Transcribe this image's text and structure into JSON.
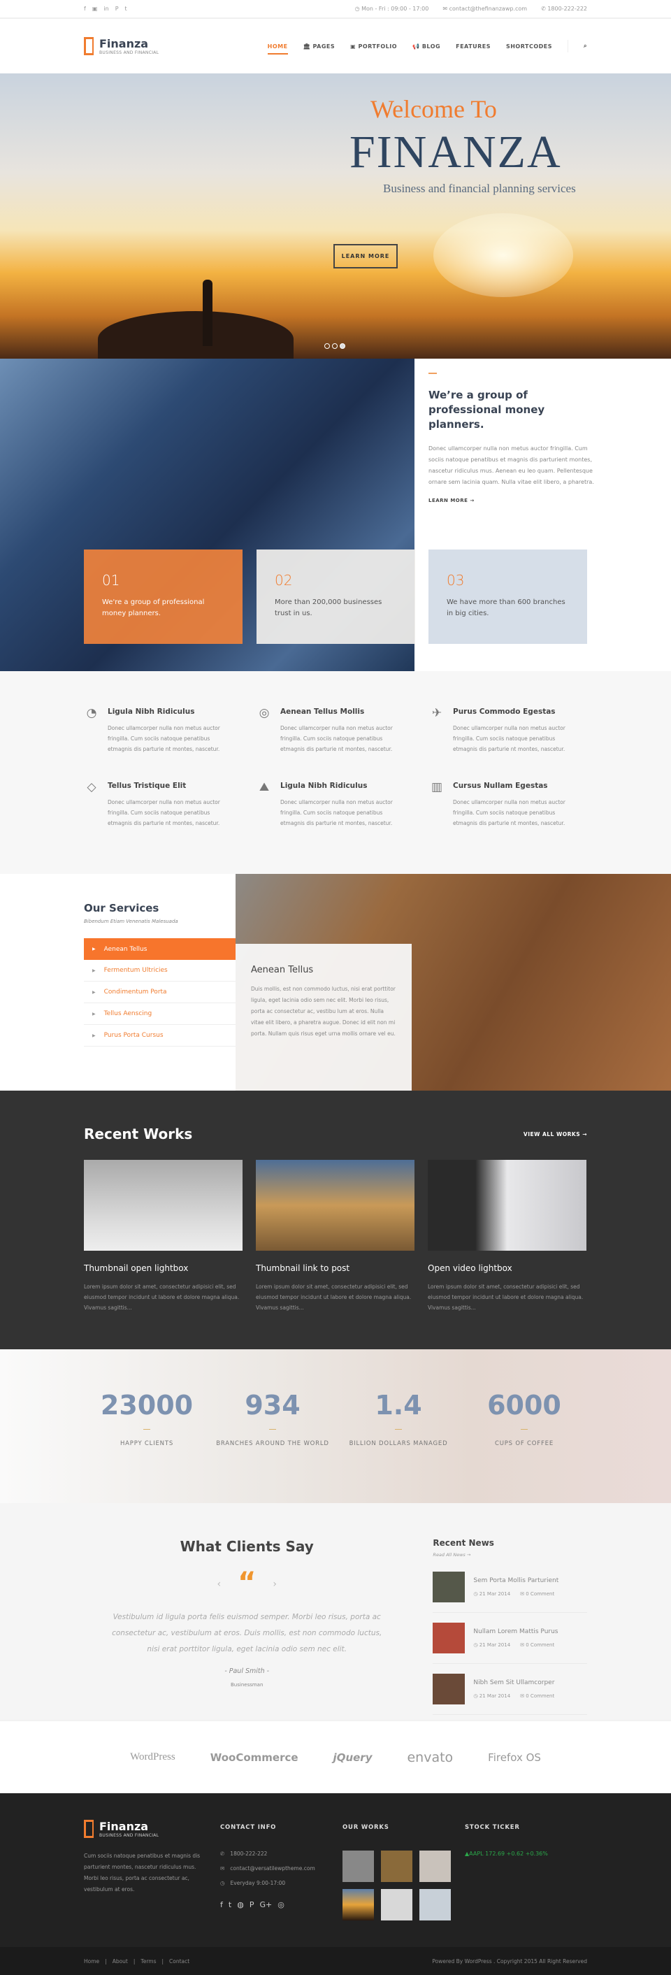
{
  "topbar": {
    "social": [
      "f",
      "▣",
      "in",
      "P",
      "t"
    ],
    "hours": "Mon - Fri : 09:00 - 17:00",
    "email": "contact@thefinanzawp.com",
    "phone": "1800-222-222"
  },
  "brand": {
    "name": "Finanza",
    "tagline": "BUSINESS AND FINANCIAL",
    "accent": "#f07c2f"
  },
  "nav": [
    "HOME",
    "PAGES",
    "PORTFOLIO",
    "BLOG",
    "FEATURES",
    "SHORTCODES"
  ],
  "hero": {
    "welcome": "Welcome To",
    "title": "FINANZA",
    "subtitle": "Business and financial planning services",
    "button": "LEARN MORE",
    "slides": 3,
    "active_slide": 3
  },
  "about": {
    "heading": "We’re a group of professional money planners.",
    "body": "Donec ullamcorper nulla non metus auctor fringilla. Cum sociis natoque penatibus et magnis dis parturient montes, nascetur ridiculus mus. Aenean eu leo quam. Pellentesque ornare sem lacinia quam. Nulla vitae elit libero, a pharetra.",
    "more": "LEARN MORE →",
    "cards": [
      {
        "num": "01",
        "text": "We're a group of professional money planners."
      },
      {
        "num": "02",
        "text": "More than 200,000 businesses trust in us."
      },
      {
        "num": "03",
        "text": "We have more than 600 branches in big cities."
      }
    ]
  },
  "features": [
    {
      "icon": "pie-chart-icon",
      "glyph": "◔",
      "title": "Ligula Nibh Ridiculus",
      "text": "Donec ullamcorper nulla non metus auctor fringilla. Cum sociis natoque penatibus etmagnis dis parturie nt montes, nascetur."
    },
    {
      "icon": "target-icon",
      "glyph": "◎",
      "title": "Aenean Tellus Mollis",
      "text": "Donec ullamcorper nulla non metus auctor fringilla. Cum sociis natoque penatibus etmagnis dis parturie nt montes, nascetur."
    },
    {
      "icon": "paper-plane-icon",
      "glyph": "✈",
      "title": "Purus Commodo Egestas",
      "text": "Donec ullamcorper nulla non metus auctor fringilla. Cum sociis natoque penatibus etmagnis dis parturie nt montes, nascetur."
    },
    {
      "icon": "diamond-icon",
      "glyph": "◇",
      "title": "Tellus Tristique Elit",
      "text": "Donec ullamcorper nulla non metus auctor fringilla. Cum sociis natoque penatibus etmagnis dis parturie nt montes, nascetur."
    },
    {
      "icon": "area-chart-icon",
      "glyph": "⛰",
      "title": "Ligula Nibh Ridiculus",
      "text": "Donec ullamcorper nulla non metus auctor fringilla. Cum sociis natoque penatibus etmagnis dis parturie nt montes, nascetur."
    },
    {
      "icon": "bar-chart-icon",
      "glyph": "▥",
      "title": "Cursus Nullam Egestas",
      "text": "Donec ullamcorper nulla non metus auctor fringilla. Cum sociis natoque penatibus etmagnis dis parturie nt montes, nascetur."
    }
  ],
  "services": {
    "title": "Our Services",
    "subtitle": "Bibendum Etiam Venenatis Malesuada",
    "items": [
      "Aenean Tellus",
      "Fermentum Ultricies",
      "Condimentum Porta",
      "Tellus Aenscing",
      "Purus Porta Cursus"
    ],
    "panel_title": "Aenean Tellus",
    "panel_text": "Duis mollis, est non commodo luctus, nisi erat porttitor ligula, eget lacinia odio sem nec elit. Morbi leo risus, porta ac consectetur ac, vestibu lum at eros. Nulla vitae elit libero, a pharetra augue. Donec id elit non mi porta. Nullam quis risus eget urna mollis ornare vel eu."
  },
  "works": {
    "title": "Recent Works",
    "view_all": "VIEW ALL WORKS →",
    "items": [
      {
        "title": "Thumbnail open lightbox",
        "text": "Lorem ipsum dolor sit amet, consectetur adipisici elit, sed eiusmod tempor incidunt ut labore et dolore magna aliqua. Vivamus sagittis..."
      },
      {
        "title": "Thumbnail link to post",
        "text": "Lorem ipsum dolor sit amet, consectetur adipisici elit, sed eiusmod tempor incidunt ut labore et dolore magna aliqua. Vivamus sagittis..."
      },
      {
        "title": "Open video lightbox",
        "text": "Lorem ipsum dolor sit amet, consectetur adipisici elit, sed eiusmod tempor incidunt ut labore et dolore magna aliqua. Vivamus sagittis..."
      }
    ]
  },
  "stats": [
    {
      "value": "23000",
      "label": "HAPPY CLIENTS"
    },
    {
      "value": "934",
      "label": "BRANCHES AROUND THE WORLD"
    },
    {
      "value": "1.4",
      "label": "BILLION DOLLARS MANAGED"
    },
    {
      "value": "6000",
      "label": "CUPS OF COFFEE"
    }
  ],
  "testimonial": {
    "title": "What Clients Say",
    "quote": "Vestibulum id ligula porta felis euismod semper. Morbi leo risus, porta ac consectetur ac, vestibulum at eros. Duis mollis, est non commodo luctus, nisi erat porttitor ligula, eget lacinia odio sem nec elit.",
    "author": "- Paul Smith -",
    "role": "Businessman"
  },
  "news": {
    "title": "Recent News",
    "read_all": "Read All News →",
    "items": [
      {
        "title": "Sem Porta Mollis Parturient",
        "date": "21 Mar 2014",
        "comments": "0 Comment"
      },
      {
        "title": "Nullam Lorem Mattis Purus",
        "date": "21 Mar 2014",
        "comments": "0 Comment"
      },
      {
        "title": "Nibh Sem Sit Ullamcorper",
        "date": "21 Mar 2014",
        "comments": "0 Comment"
      }
    ]
  },
  "partners": [
    "WordPress",
    "WooCommerce",
    "jQuery",
    "envato",
    "Firefox OS"
  ],
  "footer": {
    "about": "Cum sociis natoque penatibus et magnis dis parturient montes, nascetur ridiculus mus. Morbi leo risus, porta ac consectetur ac, vestibulum at eros.",
    "contact_title": "CONTACT INFO",
    "phone": "1800-222-222",
    "email": "contact@versatilewptheme.com",
    "hours": "Everyday 9:00-17:00",
    "social": [
      "f",
      "t",
      "◍",
      "P",
      "G+",
      "◎"
    ],
    "works_title": "OUR WORKS",
    "ticker_title": "STOCK TICKER",
    "ticker": "AAPL 172.69 +0.62 +0.36%",
    "ticker_color": "#2ba84a",
    "links": [
      "Home",
      "About",
      "Terms",
      "Contact"
    ],
    "copyright": "Powered By WordPress . Copyright 2015 All Right Reserved"
  }
}
